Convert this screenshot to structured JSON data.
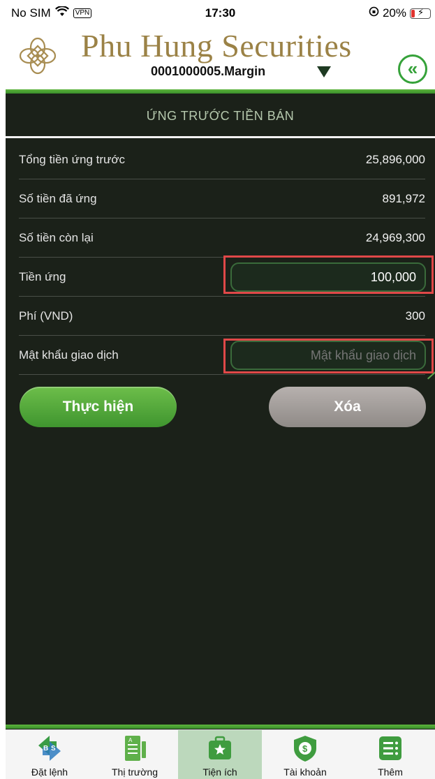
{
  "status_bar": {
    "carrier": "No SIM",
    "vpn": "VPN",
    "time": "17:30",
    "battery": "20%",
    "battery_level": 0.2
  },
  "header": {
    "brand": "Phu Hung Securities",
    "account": "0001000005.Margin",
    "brand_color": "#9b8246",
    "accent_color": "#36a23a"
  },
  "panel": {
    "title": "ỨNG TRƯỚC TIỀN BÁN",
    "rows": [
      {
        "label": "Tổng tiền ứng trước",
        "value": "25,896,000"
      },
      {
        "label": "Số tiền đã ứng",
        "value": "891,972"
      },
      {
        "label": "Số tiền còn lại",
        "value": "24,969,300"
      }
    ],
    "advance": {
      "label": "Tiền ứng",
      "value": "100,000"
    },
    "fee": {
      "label": "Phí (VND)",
      "value": "300"
    },
    "password": {
      "label": "Mật khẩu giao dịch",
      "placeholder": "Mật khẩu giao dịch"
    },
    "submit_label": "Thực hiện",
    "clear_label": "Xóa"
  },
  "tabs": [
    {
      "label": "Đặt lệnh",
      "icon": "order-icon",
      "active": false
    },
    {
      "label": "Thị trường",
      "icon": "market-icon",
      "active": false
    },
    {
      "label": "Tiện ích",
      "icon": "utility-icon",
      "active": true
    },
    {
      "label": "Tài khoản",
      "icon": "account-icon",
      "active": false
    },
    {
      "label": "Thêm",
      "icon": "more-icon",
      "active": false
    }
  ]
}
